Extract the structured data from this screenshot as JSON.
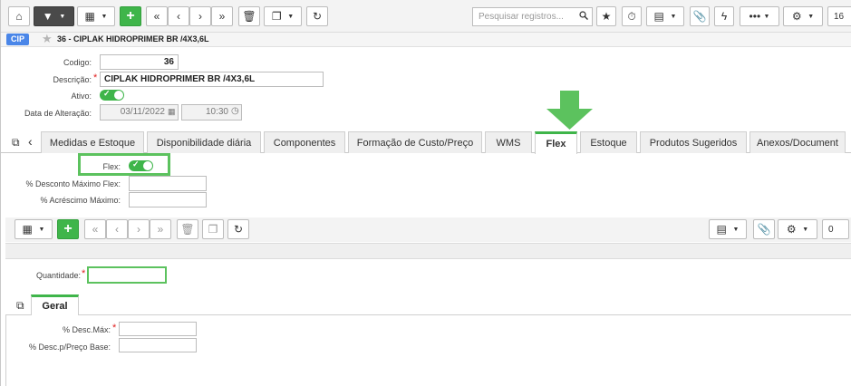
{
  "toolbar": {
    "search_placeholder": "Pesquisar registros...",
    "page_number": "16"
  },
  "record": {
    "badge": "CIP",
    "title": "36 - CIPLAK HIDROPRIMER BR /4X3,6L"
  },
  "form": {
    "codigo_label": "Codigo:",
    "codigo_value": "36",
    "descricao_label": "Descrição:",
    "descricao_value": "CIPLAK HIDROPRIMER BR /4X3,6L",
    "ativo_label": "Ativo:",
    "data_alteracao_label": "Data de Alteração:",
    "date_value": "03/11/2022",
    "time_value": "10:30"
  },
  "tabs": [
    "Medidas e Estoque",
    "Disponibilidade diária",
    "Componentes",
    "Formação de Custo/Preço",
    "WMS",
    "Flex",
    "Estoque",
    "Produtos Sugeridos",
    "Anexos/Document"
  ],
  "active_tab": "Flex",
  "flex": {
    "flex_label": "Flex:",
    "desconto_label": "% Desconto Máximo Flex:",
    "acrescimo_label": "% Acréscimo Máximo:"
  },
  "grid_toolbar": {
    "page_number": "0"
  },
  "detail": {
    "quantidade_label": "Quantidade:",
    "subtab_label": "Geral",
    "desc_max_label": "% Desc.Máx:",
    "desc_preco_base_label": "% Desc.p/Preço Base:"
  },
  "colors": {
    "accent_green": "#3fb54a",
    "annotation_green": "#5cc25e",
    "badge_blue": "#4a86e8",
    "required_red": "#e02020"
  }
}
